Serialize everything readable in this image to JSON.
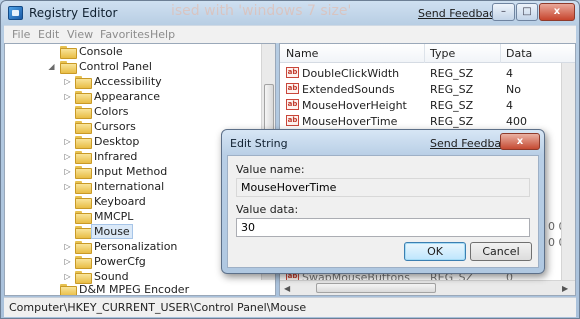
{
  "window": {
    "title": "Registry Editor",
    "watermark": "ised with 'windows 7 size'",
    "send_feedback": "Send Feedback",
    "min_glyph": "–",
    "max_glyph": "□",
    "close_glyph": "x"
  },
  "menu": {
    "items": [
      "File",
      "Edit",
      "View",
      "Favorites",
      "Help"
    ]
  },
  "tree": {
    "items": [
      {
        "label": "Console"
      },
      {
        "label": "Control Panel"
      },
      {
        "label": "Accessibility"
      },
      {
        "label": "Appearance"
      },
      {
        "label": "Colors"
      },
      {
        "label": "Cursors"
      },
      {
        "label": "Desktop"
      },
      {
        "label": "Infrared"
      },
      {
        "label": "Input Method"
      },
      {
        "label": "International"
      },
      {
        "label": "Keyboard"
      },
      {
        "label": "MMCPL"
      },
      {
        "label": "Mouse"
      },
      {
        "label": "Personalization"
      },
      {
        "label": "PowerCfg"
      },
      {
        "label": "Sound"
      },
      {
        "label": "D&M MPEG Encoder"
      }
    ]
  },
  "list": {
    "columns": {
      "name": "Name",
      "type": "Type",
      "data": "Data"
    },
    "rows": [
      {
        "name": "DoubleClickWidth",
        "type": "REG_SZ",
        "data": "4"
      },
      {
        "name": "ExtendedSounds",
        "type": "REG_SZ",
        "data": "No"
      },
      {
        "name": "MouseHoverHeight",
        "type": "REG_SZ",
        "data": "4"
      },
      {
        "name": "MouseHoverTime",
        "type": "REG_SZ",
        "data": "400"
      }
    ],
    "partial_rows": [
      {
        "name": "SwapMouseButtons",
        "type": "REG_SZ",
        "data": "0"
      }
    ],
    "hidden_values_right": [
      "0 0",
      "0 0"
    ]
  },
  "status": {
    "path": "Computer\\HKEY_CURRENT_USER\\Control Panel\\Mouse"
  },
  "dialog": {
    "title": "Edit String",
    "send_feedback": "Send Feedback",
    "close_glyph": "x",
    "value_name_label": "Value name:",
    "value_name": "MouseHoverTime",
    "value_data_label": "Value data:",
    "value_data": "30",
    "ok_label": "OK",
    "cancel_label": "Cancel"
  },
  "icons": {
    "string_value": "ab",
    "expand": "▷",
    "collapse": "◢"
  }
}
